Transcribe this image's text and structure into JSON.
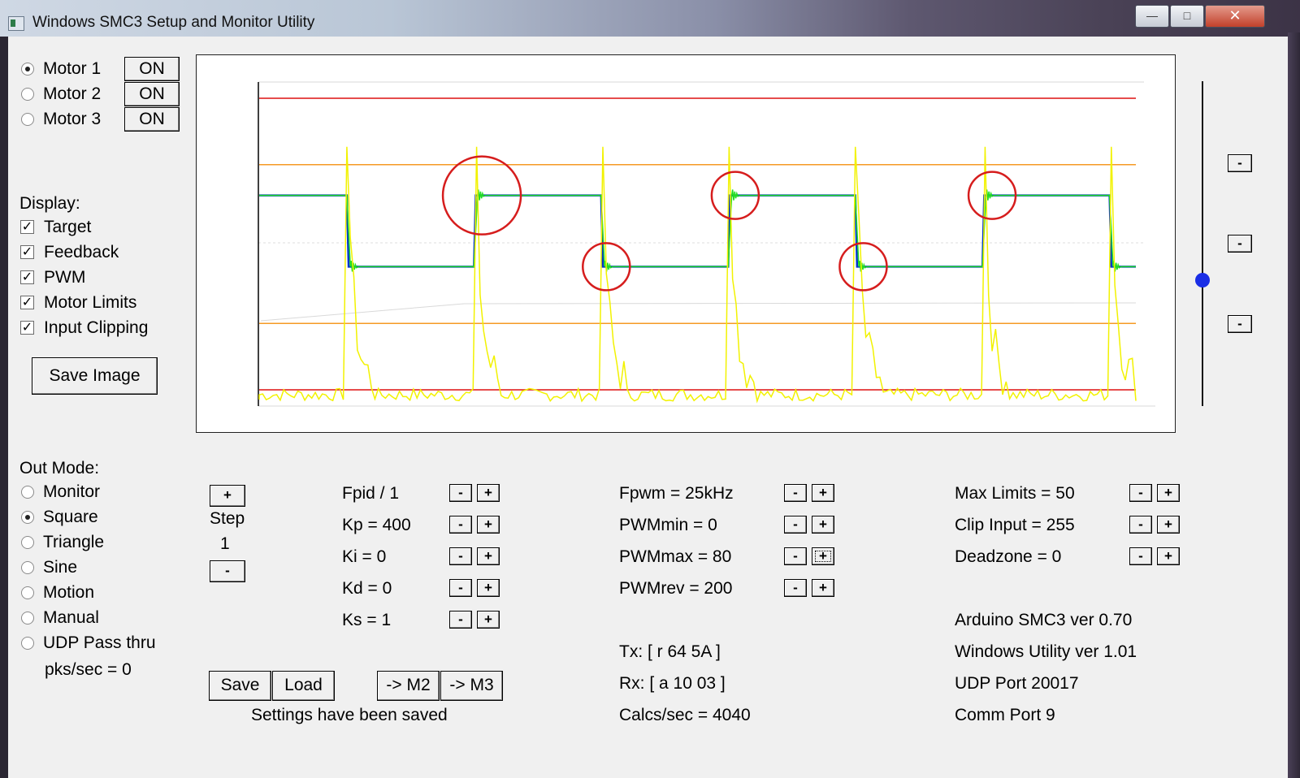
{
  "window": {
    "title": "Windows SMC3 Setup and Monitor Utility",
    "minimize": "—",
    "maximize": "□",
    "close": "✕"
  },
  "motors": [
    {
      "label": "Motor 1",
      "selected": true,
      "state": "ON"
    },
    {
      "label": "Motor 2",
      "selected": false,
      "state": "ON"
    },
    {
      "label": "Motor 3",
      "selected": false,
      "state": "ON"
    }
  ],
  "display": {
    "heading": "Display:",
    "options": [
      {
        "label": "Target",
        "checked": true
      },
      {
        "label": "Feedback",
        "checked": true
      },
      {
        "label": "PWM",
        "checked": true
      },
      {
        "label": "Motor Limits",
        "checked": true
      },
      {
        "label": "Input Clipping",
        "checked": true
      }
    ],
    "save_image": "Save Image"
  },
  "out_mode": {
    "heading": "Out Mode:",
    "options": [
      {
        "label": "Monitor",
        "selected": false
      },
      {
        "label": "Square",
        "selected": true
      },
      {
        "label": "Triangle",
        "selected": false
      },
      {
        "label": "Sine",
        "selected": false
      },
      {
        "label": "Motion",
        "selected": false
      },
      {
        "label": "Manual",
        "selected": false
      },
      {
        "label": "UDP Pass thru",
        "selected": false
      }
    ],
    "pks": "pks/sec = 0"
  },
  "step": {
    "plus": "+",
    "label": "Step",
    "value": "1",
    "minus": "-"
  },
  "pid": [
    {
      "label": "Fpid / 1"
    },
    {
      "label": "Kp = 400"
    },
    {
      "label": "Ki = 0"
    },
    {
      "label": "Kd = 0"
    },
    {
      "label": "Ks = 1"
    }
  ],
  "pwm": [
    {
      "label": "Fpwm = 25kHz"
    },
    {
      "label": "PWMmin = 0"
    },
    {
      "label": "PWMmax = 80"
    },
    {
      "label": "PWMrev = 200"
    }
  ],
  "limits": [
    {
      "label": "Max Limits = 50"
    },
    {
      "label": "Clip Input = 255"
    },
    {
      "label": "Deadzone = 0"
    }
  ],
  "buttons": {
    "minus": "-",
    "plus": "+",
    "save": "Save",
    "load": "Load",
    "to_m2": "-> M2",
    "to_m3": "-> M3"
  },
  "status": "Settings have been saved",
  "comms": {
    "tx": "Tx: [ r 64 5A ]",
    "rx": "Rx: [ a 10 03 ]",
    "calcs": "Calcs/sec = 4040"
  },
  "info": {
    "arduino": "Arduino SMC3 ver 0.70",
    "utility": "Windows Utility ver 1.01",
    "udp": "UDP Port 20017",
    "comm": "Comm Port 9"
  },
  "colors": {
    "target": "#0033cc",
    "feedback": "#22dd22",
    "pwm": "#f2f200",
    "motor_limits": "#dd1111",
    "input_clipping": "#f59a24",
    "circles": "#d61d1d",
    "slider_knob": "#1a2ee6"
  },
  "chart_data": {
    "type": "line",
    "title": "",
    "xlabel": "",
    "ylabel": "",
    "x_range": [
      0,
      1000
    ],
    "y_range": [
      0,
      1000
    ],
    "target_levels": {
      "high": 650,
      "low": 430
    },
    "step_times": [
      100,
      245,
      390,
      535,
      680,
      825,
      970
    ],
    "pwm_spike_times": [
      100,
      245,
      390,
      535,
      680,
      825,
      970
    ],
    "motor_limits": [
      950,
      50
    ],
    "input_clipping": [
      745,
      255
    ],
    "highlighted_overshoots": [
      252,
      395,
      542,
      688,
      835
    ]
  }
}
